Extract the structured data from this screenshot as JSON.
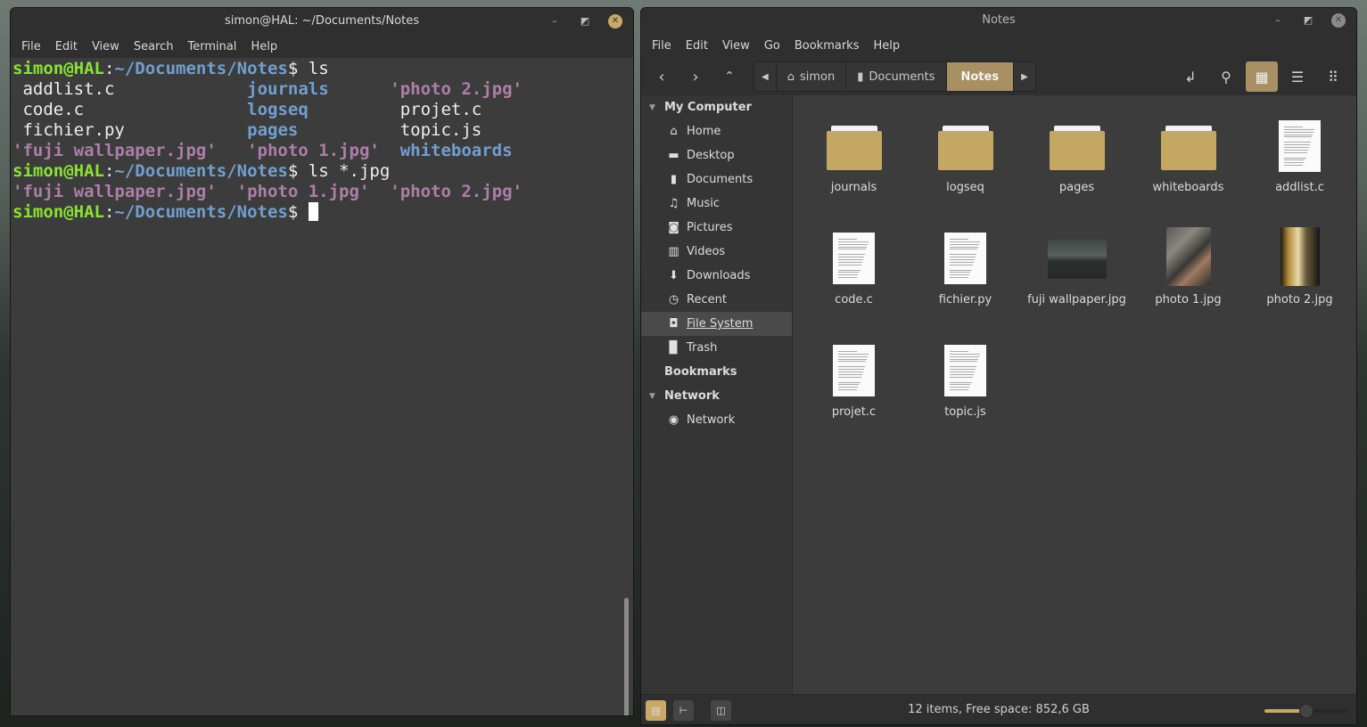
{
  "terminal": {
    "title": "simon@HAL: ~/Documents/Notes",
    "menu": [
      "File",
      "Edit",
      "View",
      "Search",
      "Terminal",
      "Help"
    ],
    "prompt_user": "simon@HAL",
    "prompt_sep": ":",
    "prompt_path": "~/Documents/Notes",
    "prompt_dollar": "$ ",
    "cmd1": "ls",
    "cmd2": "ls *.jpg",
    "ls_output": [
      [
        {
          "t": " addlist.c",
          "c": "file"
        },
        {
          "t": "journals",
          "c": "dir"
        },
        {
          "t": "'photo 2.jpg'",
          "c": "img"
        }
      ],
      [
        {
          "t": " code.c",
          "c": "file"
        },
        {
          "t": "logseq",
          "c": "dir"
        },
        {
          "t": " projet.c",
          "c": "file"
        }
      ],
      [
        {
          "t": " fichier.py",
          "c": "file"
        },
        {
          "t": "pages",
          "c": "dir"
        },
        {
          "t": " topic.js",
          "c": "file"
        }
      ],
      [
        {
          "t": "'fuji wallpaper.jpg'",
          "c": "img"
        },
        {
          "t": "'photo 1.jpg'",
          "c": "img"
        },
        {
          "t": " whiteboards",
          "c": "dir"
        }
      ]
    ],
    "jpg_output": [
      {
        "t": "'fuji wallpaper.jpg'",
        "c": "img"
      },
      {
        "t": "'photo 1.jpg'",
        "c": "img"
      },
      {
        "t": "'photo 2.jpg'",
        "c": "img"
      }
    ]
  },
  "files": {
    "title": "Notes",
    "menu": [
      "File",
      "Edit",
      "View",
      "Go",
      "Bookmarks",
      "Help"
    ],
    "breadcrumb": [
      "simon",
      "Documents",
      "Notes"
    ],
    "sidebar": {
      "my_computer": "My Computer",
      "places": [
        {
          "label": "Home",
          "icon": "home-icon",
          "glyph": "⌂"
        },
        {
          "label": "Desktop",
          "icon": "desktop-icon",
          "glyph": "▬"
        },
        {
          "label": "Documents",
          "icon": "document-icon",
          "glyph": "▮"
        },
        {
          "label": "Music",
          "icon": "music-icon",
          "glyph": "♫"
        },
        {
          "label": "Pictures",
          "icon": "camera-icon",
          "glyph": "◙"
        },
        {
          "label": "Videos",
          "icon": "film-icon",
          "glyph": "▥"
        },
        {
          "label": "Downloads",
          "icon": "download-icon",
          "glyph": "⬇"
        },
        {
          "label": "Recent",
          "icon": "clock-icon",
          "glyph": "◷"
        },
        {
          "label": "File System",
          "icon": "drive-icon",
          "glyph": "◘",
          "selected": true
        },
        {
          "label": "Trash",
          "icon": "trash-icon",
          "glyph": "▉"
        }
      ],
      "bookmarks": "Bookmarks",
      "network_head": "Network",
      "network": [
        {
          "label": "Network",
          "icon": "globe-icon",
          "glyph": "◉"
        }
      ]
    },
    "items": [
      {
        "name": "journals",
        "type": "folder"
      },
      {
        "name": "logseq",
        "type": "folder"
      },
      {
        "name": "pages",
        "type": "folder"
      },
      {
        "name": "whiteboards",
        "type": "folder"
      },
      {
        "name": "addlist.c",
        "type": "doc"
      },
      {
        "name": "code.c",
        "type": "doc"
      },
      {
        "name": "fichier.py",
        "type": "doc"
      },
      {
        "name": "fuji wallpaper.jpg",
        "type": "landscape"
      },
      {
        "name": "photo 1.jpg",
        "type": "photo1"
      },
      {
        "name": "photo 2.jpg",
        "type": "photo2"
      },
      {
        "name": "projet.c",
        "type": "doc"
      },
      {
        "name": "topic.js",
        "type": "doc"
      }
    ],
    "status": "12 items, Free space: 852,6 GB",
    "zoom_level_fraction": 0.5,
    "colors": {
      "accent": "#c9a96a",
      "folder": "#c5a764"
    }
  }
}
